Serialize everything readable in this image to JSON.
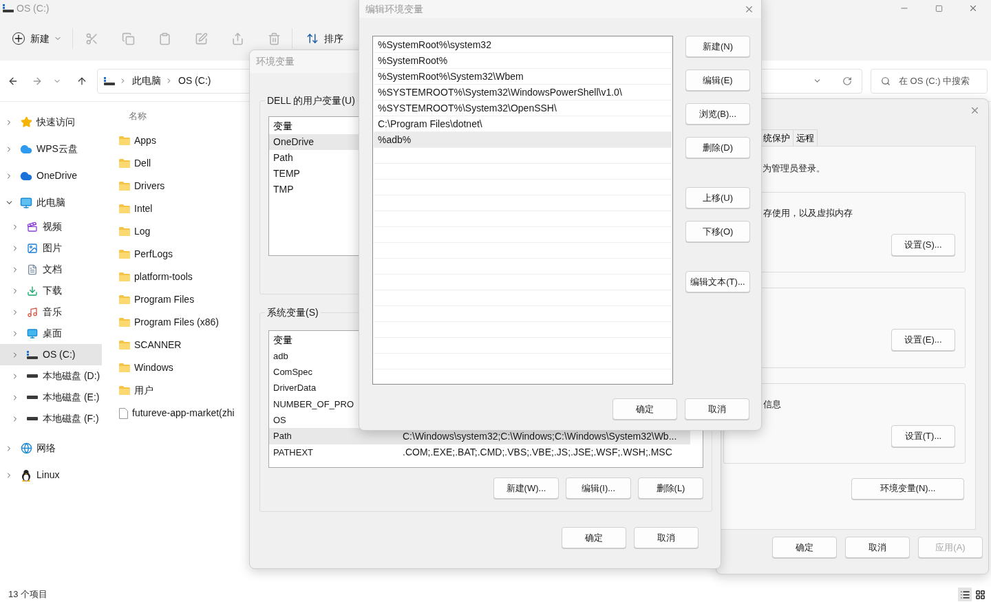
{
  "explorer": {
    "title": "OS (C:)",
    "toolbar": {
      "new_label": "新建",
      "sort_label": "排序"
    },
    "breadcrumb": [
      "此电脑",
      "OS (C:)"
    ],
    "search": {
      "placeholder": "在 OS (C:) 中搜索"
    },
    "sidebar": [
      {
        "label": "快速访问",
        "kind": "star",
        "expanded": false,
        "selected": false
      },
      {
        "label": "WPS云盘",
        "kind": "wps",
        "expanded": false,
        "selected": false
      },
      {
        "label": "OneDrive",
        "kind": "cloud",
        "expanded": false,
        "selected": false
      },
      {
        "label": "此电脑",
        "kind": "pc",
        "expanded": true,
        "selected": false,
        "children": [
          {
            "label": "视频",
            "kind": "video",
            "expanded": false,
            "selected": false
          },
          {
            "label": "图片",
            "kind": "picture",
            "expanded": false,
            "selected": false
          },
          {
            "label": "文档",
            "kind": "document",
            "expanded": false,
            "selected": false
          },
          {
            "label": "下载",
            "kind": "download",
            "expanded": false,
            "selected": false
          },
          {
            "label": "音乐",
            "kind": "music",
            "expanded": false,
            "selected": false
          },
          {
            "label": "桌面",
            "kind": "desktop",
            "expanded": false,
            "selected": false
          },
          {
            "label": "OS (C:)",
            "kind": "osdrive",
            "expanded": false,
            "selected": true
          },
          {
            "label": "本地磁盘 (D:)",
            "kind": "drive",
            "expanded": false,
            "selected": false
          },
          {
            "label": "本地磁盘 (E:)",
            "kind": "drive",
            "expanded": false,
            "selected": false
          },
          {
            "label": "本地磁盘 (F:)",
            "kind": "drive",
            "expanded": false,
            "selected": false
          }
        ]
      },
      {
        "label": "网络",
        "kind": "network",
        "expanded": false,
        "selected": false
      },
      {
        "label": "Linux",
        "kind": "linux",
        "expanded": false,
        "selected": false
      }
    ],
    "column_header": "名称",
    "files": [
      {
        "name": "Apps",
        "kind": "folder"
      },
      {
        "name": "Dell",
        "kind": "folder"
      },
      {
        "name": "Drivers",
        "kind": "folder"
      },
      {
        "name": "Intel",
        "kind": "folder"
      },
      {
        "name": "Log",
        "kind": "folder"
      },
      {
        "name": "PerfLogs",
        "kind": "folder"
      },
      {
        "name": "platform-tools",
        "kind": "folder"
      },
      {
        "name": "Program Files",
        "kind": "folder"
      },
      {
        "name": "Program Files (x86)",
        "kind": "folder"
      },
      {
        "name": "SCANNER",
        "kind": "folder"
      },
      {
        "name": "Windows",
        "kind": "folder"
      },
      {
        "name": "用户",
        "kind": "folder"
      },
      {
        "name": "futureve-app-market(zhi",
        "kind": "file"
      }
    ],
    "status": "13 个项目"
  },
  "system_properties": {
    "tabs": [
      {
        "label": "统保护",
        "selected": false
      },
      {
        "label": "远程",
        "selected": false
      }
    ],
    "note": "为管理员登录。",
    "groups": [
      {
        "text": "存使用，以及虚拟内存",
        "button": "设置(S)..."
      },
      {
        "button": "设置(E)..."
      },
      {
        "text": "信息",
        "button": "设置(T)..."
      }
    ],
    "env_button": "环境变量(N)...",
    "footer": [
      {
        "label": "确定",
        "disabled": false
      },
      {
        "label": "取消",
        "disabled": false
      },
      {
        "label": "应用(A)",
        "disabled": true
      }
    ]
  },
  "environment_variables": {
    "title": "环境变量",
    "user_group": "DELL 的用户变量(U)",
    "user_header": "变量",
    "user_vars": [
      {
        "name": "OneDrive",
        "selected": true
      },
      {
        "name": "Path",
        "selected": false
      },
      {
        "name": "TEMP",
        "selected": false
      },
      {
        "name": "TMP",
        "selected": false
      }
    ],
    "system_group": "系统变量(S)",
    "system_header": "变量",
    "system_vars": [
      {
        "name": "adb",
        "selected": false
      },
      {
        "name": "ComSpec",
        "selected": false
      },
      {
        "name": "DriverData",
        "selected": false
      },
      {
        "name": "NUMBER_OF_PRO",
        "selected": false
      },
      {
        "name": "OS",
        "selected": false
      },
      {
        "name": "Path",
        "value": "C:\\Windows\\system32;C:\\Windows;C:\\Windows\\System32\\Wb...",
        "selected": true
      },
      {
        "name": "PATHEXT",
        "value": ".COM;.EXE;.BAT;.CMD;.VBS;.VBE;.JS;.JSE;.WSF;.WSH;.MSC",
        "selected": false
      }
    ],
    "system_buttons": [
      "新建(W)...",
      "编辑(I)...",
      "删除(L)"
    ],
    "footer": [
      "确定",
      "取消"
    ]
  },
  "edit_dialog": {
    "title": "编辑环境变量",
    "entries": [
      {
        "text": "%SystemRoot%\\system32",
        "selected": false
      },
      {
        "text": "%SystemRoot%",
        "selected": false
      },
      {
        "text": "%SystemRoot%\\System32\\Wbem",
        "selected": false
      },
      {
        "text": "%SYSTEMROOT%\\System32\\WindowsPowerShell\\v1.0\\",
        "selected": false
      },
      {
        "text": "%SYSTEMROOT%\\System32\\OpenSSH\\",
        "selected": false
      },
      {
        "text": "C:\\Program Files\\dotnet\\",
        "selected": false
      },
      {
        "text": "%adb%",
        "selected": true
      }
    ],
    "button_groups": [
      [
        "新建(N)",
        "编辑(E)",
        "浏览(B)...",
        "删除(D)"
      ],
      [
        "上移(U)",
        "下移(O)"
      ],
      [
        "编辑文本(T)..."
      ]
    ],
    "footer": [
      "确定",
      "取消"
    ]
  }
}
